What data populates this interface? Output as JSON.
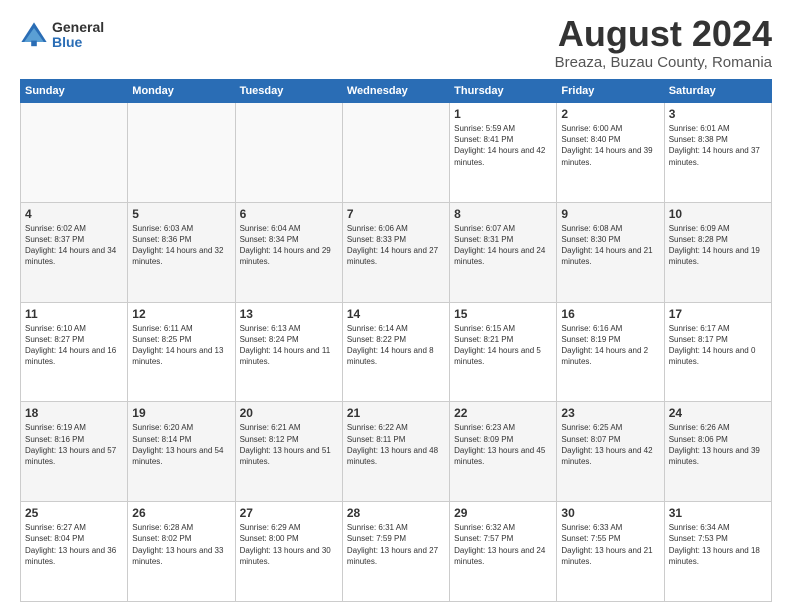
{
  "logo": {
    "general": "General",
    "blue": "Blue"
  },
  "title": "August 2024",
  "subtitle": "Breaza, Buzau County, Romania",
  "days_header": [
    "Sunday",
    "Monday",
    "Tuesday",
    "Wednesday",
    "Thursday",
    "Friday",
    "Saturday"
  ],
  "weeks": [
    [
      {
        "day": "",
        "info": ""
      },
      {
        "day": "",
        "info": ""
      },
      {
        "day": "",
        "info": ""
      },
      {
        "day": "",
        "info": ""
      },
      {
        "day": "1",
        "info": "Sunrise: 5:59 AM\nSunset: 8:41 PM\nDaylight: 14 hours and 42 minutes."
      },
      {
        "day": "2",
        "info": "Sunrise: 6:00 AM\nSunset: 8:40 PM\nDaylight: 14 hours and 39 minutes."
      },
      {
        "day": "3",
        "info": "Sunrise: 6:01 AM\nSunset: 8:38 PM\nDaylight: 14 hours and 37 minutes."
      }
    ],
    [
      {
        "day": "4",
        "info": "Sunrise: 6:02 AM\nSunset: 8:37 PM\nDaylight: 14 hours and 34 minutes."
      },
      {
        "day": "5",
        "info": "Sunrise: 6:03 AM\nSunset: 8:36 PM\nDaylight: 14 hours and 32 minutes."
      },
      {
        "day": "6",
        "info": "Sunrise: 6:04 AM\nSunset: 8:34 PM\nDaylight: 14 hours and 29 minutes."
      },
      {
        "day": "7",
        "info": "Sunrise: 6:06 AM\nSunset: 8:33 PM\nDaylight: 14 hours and 27 minutes."
      },
      {
        "day": "8",
        "info": "Sunrise: 6:07 AM\nSunset: 8:31 PM\nDaylight: 14 hours and 24 minutes."
      },
      {
        "day": "9",
        "info": "Sunrise: 6:08 AM\nSunset: 8:30 PM\nDaylight: 14 hours and 21 minutes."
      },
      {
        "day": "10",
        "info": "Sunrise: 6:09 AM\nSunset: 8:28 PM\nDaylight: 14 hours and 19 minutes."
      }
    ],
    [
      {
        "day": "11",
        "info": "Sunrise: 6:10 AM\nSunset: 8:27 PM\nDaylight: 14 hours and 16 minutes."
      },
      {
        "day": "12",
        "info": "Sunrise: 6:11 AM\nSunset: 8:25 PM\nDaylight: 14 hours and 13 minutes."
      },
      {
        "day": "13",
        "info": "Sunrise: 6:13 AM\nSunset: 8:24 PM\nDaylight: 14 hours and 11 minutes."
      },
      {
        "day": "14",
        "info": "Sunrise: 6:14 AM\nSunset: 8:22 PM\nDaylight: 14 hours and 8 minutes."
      },
      {
        "day": "15",
        "info": "Sunrise: 6:15 AM\nSunset: 8:21 PM\nDaylight: 14 hours and 5 minutes."
      },
      {
        "day": "16",
        "info": "Sunrise: 6:16 AM\nSunset: 8:19 PM\nDaylight: 14 hours and 2 minutes."
      },
      {
        "day": "17",
        "info": "Sunrise: 6:17 AM\nSunset: 8:17 PM\nDaylight: 14 hours and 0 minutes."
      }
    ],
    [
      {
        "day": "18",
        "info": "Sunrise: 6:19 AM\nSunset: 8:16 PM\nDaylight: 13 hours and 57 minutes."
      },
      {
        "day": "19",
        "info": "Sunrise: 6:20 AM\nSunset: 8:14 PM\nDaylight: 13 hours and 54 minutes."
      },
      {
        "day": "20",
        "info": "Sunrise: 6:21 AM\nSunset: 8:12 PM\nDaylight: 13 hours and 51 minutes."
      },
      {
        "day": "21",
        "info": "Sunrise: 6:22 AM\nSunset: 8:11 PM\nDaylight: 13 hours and 48 minutes."
      },
      {
        "day": "22",
        "info": "Sunrise: 6:23 AM\nSunset: 8:09 PM\nDaylight: 13 hours and 45 minutes."
      },
      {
        "day": "23",
        "info": "Sunrise: 6:25 AM\nSunset: 8:07 PM\nDaylight: 13 hours and 42 minutes."
      },
      {
        "day": "24",
        "info": "Sunrise: 6:26 AM\nSunset: 8:06 PM\nDaylight: 13 hours and 39 minutes."
      }
    ],
    [
      {
        "day": "25",
        "info": "Sunrise: 6:27 AM\nSunset: 8:04 PM\nDaylight: 13 hours and 36 minutes."
      },
      {
        "day": "26",
        "info": "Sunrise: 6:28 AM\nSunset: 8:02 PM\nDaylight: 13 hours and 33 minutes."
      },
      {
        "day": "27",
        "info": "Sunrise: 6:29 AM\nSunset: 8:00 PM\nDaylight: 13 hours and 30 minutes."
      },
      {
        "day": "28",
        "info": "Sunrise: 6:31 AM\nSunset: 7:59 PM\nDaylight: 13 hours and 27 minutes."
      },
      {
        "day": "29",
        "info": "Sunrise: 6:32 AM\nSunset: 7:57 PM\nDaylight: 13 hours and 24 minutes."
      },
      {
        "day": "30",
        "info": "Sunrise: 6:33 AM\nSunset: 7:55 PM\nDaylight: 13 hours and 21 minutes."
      },
      {
        "day": "31",
        "info": "Sunrise: 6:34 AM\nSunset: 7:53 PM\nDaylight: 13 hours and 18 minutes."
      }
    ]
  ]
}
